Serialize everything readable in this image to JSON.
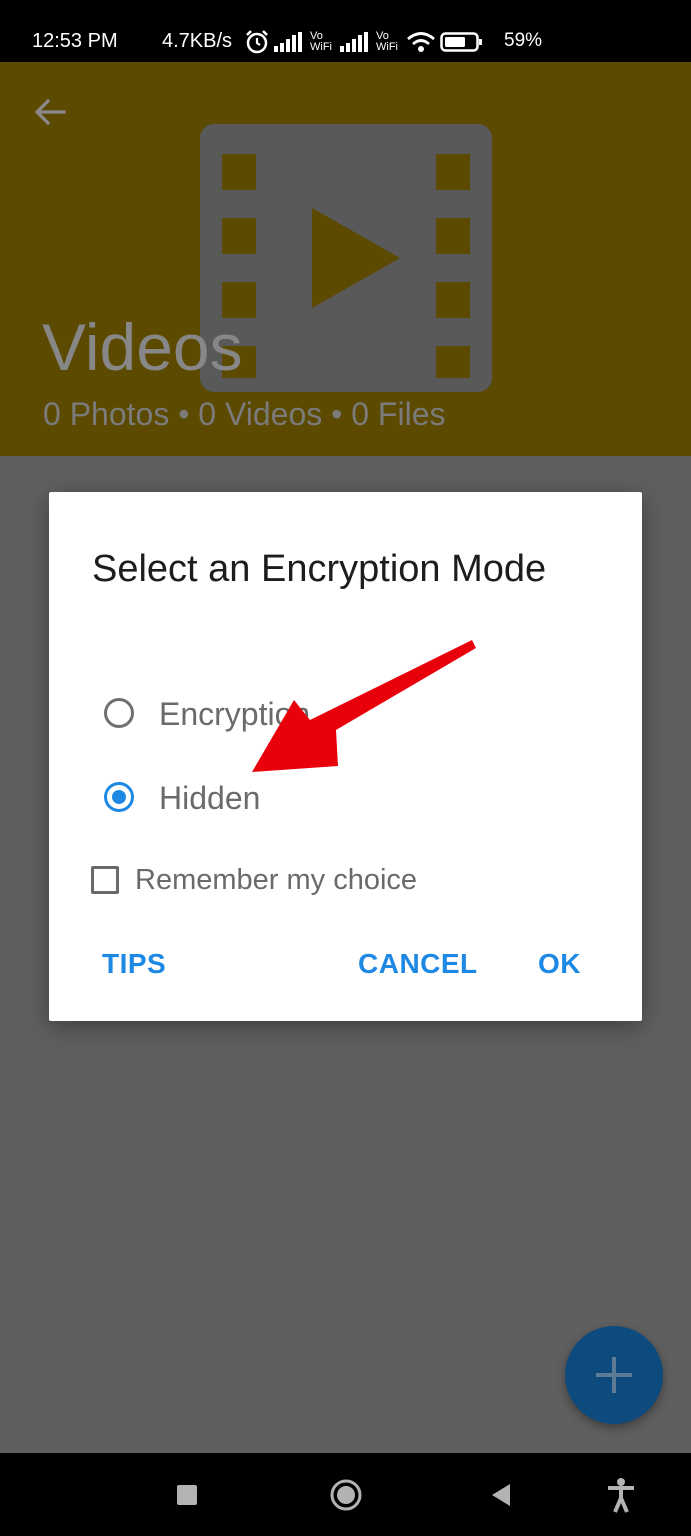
{
  "status_bar": {
    "time": "12:53 PM",
    "speed": "4.7KB/s",
    "battery": "59%",
    "icons": [
      "alarm-icon",
      "signal-icon",
      "vowifi-icon",
      "signal-icon",
      "vowifi-icon",
      "wifi-icon",
      "battery-icon"
    ],
    "vowifi_label_top": "Vo",
    "vowifi_label_bottom": "WiFi"
  },
  "header": {
    "title": "Videos",
    "subtitle": "0 Photos • 0 Videos • 0 Files",
    "background_color": "#5b4a00",
    "icons": [
      "back-arrow-icon",
      "film-play-icon"
    ]
  },
  "dialog": {
    "title": "Select an Encryption Mode",
    "options": [
      {
        "label": "Encryption",
        "selected": false
      },
      {
        "label": "Hidden",
        "selected": true
      }
    ],
    "checkbox": {
      "label": "Remember my choice",
      "checked": false
    },
    "buttons": {
      "tips": "TIPS",
      "cancel": "CANCEL",
      "ok": "OK"
    },
    "accent_color": "#1e88e5"
  },
  "annotation": {
    "type": "red-arrow-icon",
    "color": "#e8000b"
  },
  "fab": {
    "icon": "plus-icon",
    "color": "#0d4a7e"
  },
  "nav_bar": {
    "icons": [
      "square-recents-icon",
      "circle-home-icon",
      "triangle-back-icon",
      "accessibility-icon"
    ]
  }
}
